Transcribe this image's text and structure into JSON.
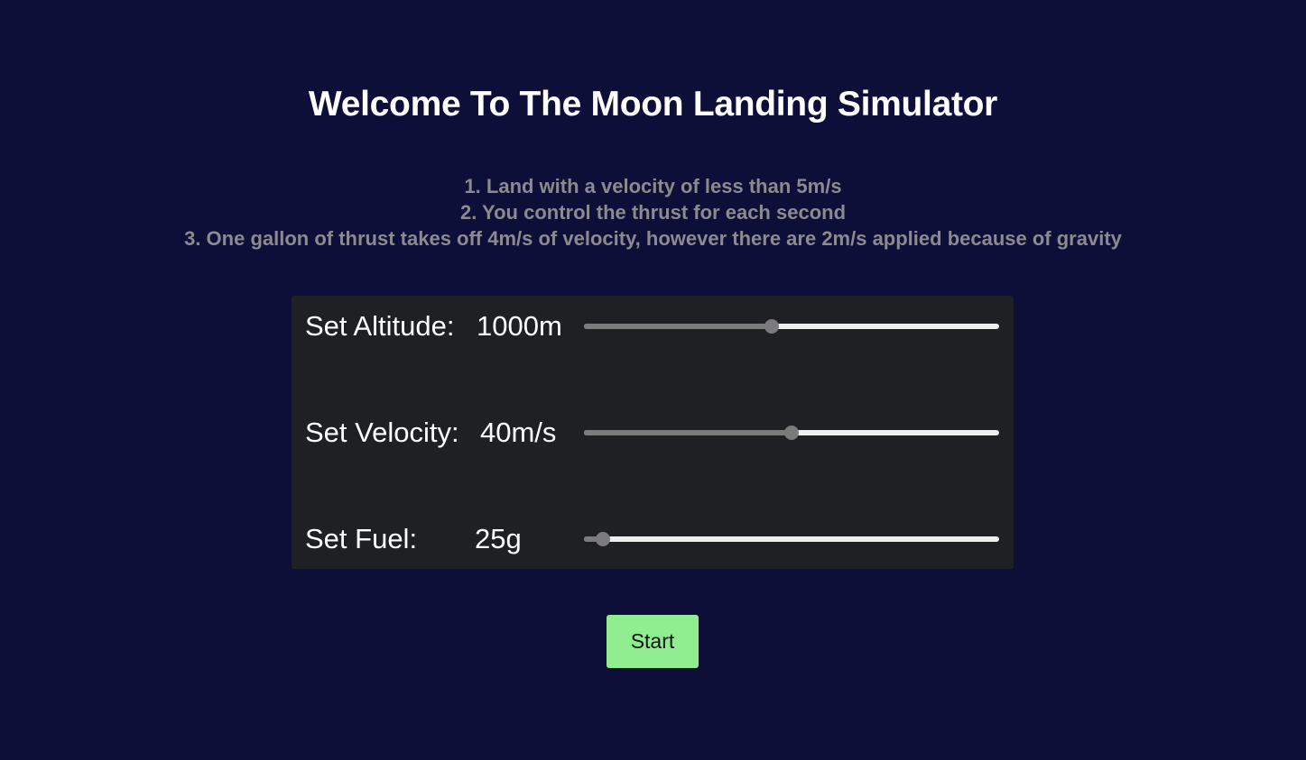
{
  "title": "Welcome To The Moon Landing Simulator",
  "rules": [
    "1. Land with a velocity of less than 5m/s",
    "2. You control the thrust for each second",
    "3. One gallon of thrust takes off 4m/s of velocity, however there are 2m/s applied because of gravity"
  ],
  "settings": {
    "altitude": {
      "label": "Set Altitude:",
      "value_text": "1000m",
      "slider_fraction": 0.45
    },
    "velocity": {
      "label": "Set Velocity:",
      "value_text": "40m/s",
      "slider_fraction": 0.5
    },
    "fuel": {
      "label": "Set Fuel:",
      "value_text": "25g",
      "slider_fraction": 0.03
    }
  },
  "start_button": {
    "label": "Start"
  },
  "colors": {
    "background": "#0e0f38",
    "panel": "#1f2023",
    "rule_text": "#8a8a8f",
    "slider_track": "#efefef",
    "slider_fill": "#7b7b7b",
    "start_button": "#90ee90"
  }
}
